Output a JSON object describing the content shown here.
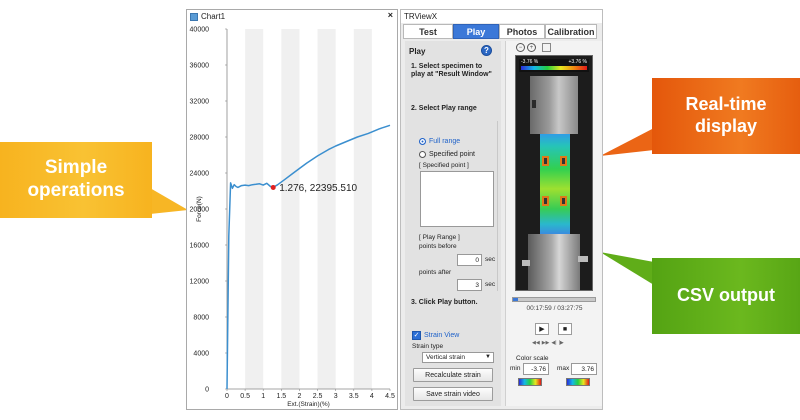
{
  "callouts": {
    "simple_line1": "Simple",
    "simple_line2": "operations",
    "realtime_line1": "Real-time",
    "realtime_line2": "display",
    "csv": "CSV output",
    "colors": {
      "simple": "#f9bd2a",
      "realtime": "#ec6a16",
      "csv": "#62b11a"
    }
  },
  "chart_window": {
    "title": "Chart1",
    "close_glyph": "×"
  },
  "chart_data": {
    "type": "line",
    "xlabel": "Ext.(Strain)(%)",
    "ylabel": "Force(N)",
    "xlim": [
      0,
      4.5
    ],
    "ylim": [
      0,
      40000
    ],
    "x_ticks": [
      "0",
      "0.5",
      "1",
      "1.5",
      "2",
      "2.5",
      "3",
      "3.5",
      "4",
      "4.5"
    ],
    "y_ticks": [
      "0",
      "4000",
      "8000",
      "12000",
      "16000",
      "20000",
      "24000",
      "28000",
      "32000",
      "36000",
      "40000"
    ],
    "series": [
      {
        "color": "#3b8fcf",
        "x": [
          0,
          0.05,
          0.1,
          0.15,
          0.2,
          0.25,
          0.3,
          0.4,
          0.5,
          0.6,
          0.7,
          0.8,
          0.9,
          1.0,
          1.1,
          1.2,
          1.276,
          1.4,
          1.6,
          1.8,
          2.0,
          2.2,
          2.5,
          2.8,
          3.0,
          3.3,
          3.6,
          3.9,
          4.2,
          4.5
        ],
        "y": [
          0,
          17000,
          22900,
          22300,
          22700,
          22500,
          22400,
          22600,
          22650,
          22600,
          22700,
          22750,
          22800,
          22650,
          22850,
          22500,
          22396,
          22700,
          23300,
          23900,
          24500,
          25100,
          25900,
          26600,
          27000,
          27500,
          28000,
          28400,
          28900,
          29300
        ]
      }
    ],
    "marker": {
      "x": 1.276,
      "y": 22395.51,
      "label": "1.276, 22395.510",
      "color": "#e02020"
    },
    "grid": "vertical bands"
  },
  "trview": {
    "title": "TRViewX",
    "tabs": [
      "Test",
      "Play",
      "Photos",
      "Calibration"
    ],
    "active_tab": "Play",
    "panel_heading": "Play",
    "help_glyph": "?",
    "step1": "1.  Select specimen to play at \"Result Window\"",
    "step2": "2.  Select Play range",
    "radio_full": "Full range",
    "radio_specified": "Specified point",
    "specified_label": "[ Specified point ]",
    "play_range_label": "[ Play Range ]",
    "points_before": "points before",
    "before_value": "0",
    "after_value": "3",
    "points_after": "points after",
    "sec": "sec",
    "step3": "3.  Click Play button.",
    "strain_view": "Strain View",
    "strain_type_label": "Strain type",
    "strain_type_value": "Vertical strain",
    "recalculate_button": "Recalculate strain",
    "save_video_button": "Save strain video",
    "scale_min_label": "-3.76 %",
    "scale_max_label": "+3.76 %",
    "time_readout": "00:17:59 / 03:27:75",
    "color_scale": "Color scale",
    "min_label": "min",
    "min_value": "-3.76",
    "max_label": "max",
    "max_value": "3.76"
  }
}
